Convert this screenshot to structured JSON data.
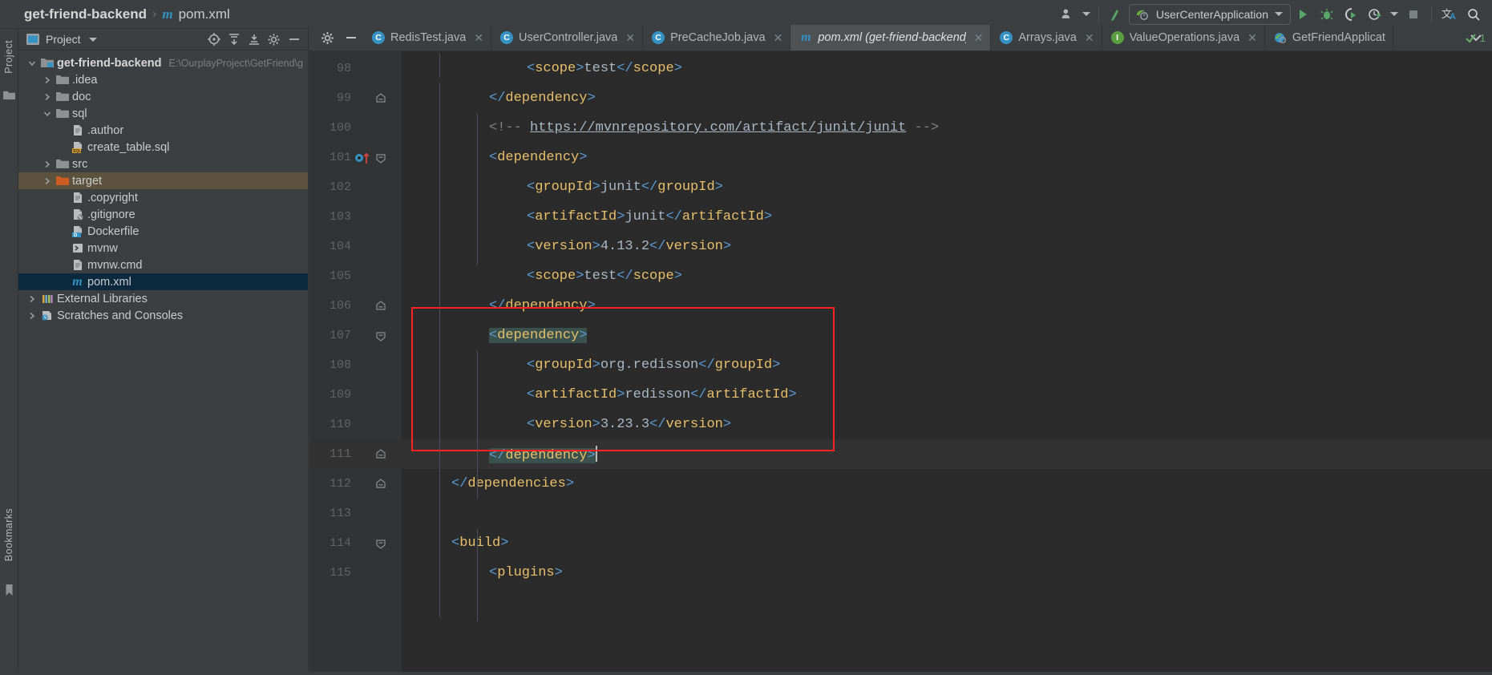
{
  "window": {
    "breadcrumb": {
      "project": "get-friend-backend",
      "separator": "›",
      "file_icon": "m",
      "file": "pom.xml"
    }
  },
  "toolbar": {
    "user_icon": "user-icon",
    "updates_icon": "vcs-update-icon",
    "run_config": {
      "label": "UserCenterApplication",
      "icon": "spring-boot-icon"
    },
    "run_label": "Run",
    "debug_label": "Debug",
    "coverage_label": "Run with Coverage",
    "profiler_label": "Profiler",
    "stop_label": "Stop",
    "translate_label": "Translate",
    "search_label": "Search Everywhere"
  },
  "stripes": {
    "left_top": "Project",
    "left_bottom": "Bookmarks"
  },
  "project_panel": {
    "title": "Project",
    "tools": [
      {
        "name": "select-opened-file-icon"
      },
      {
        "name": "expand-all-icon"
      },
      {
        "name": "collapse-all-icon"
      },
      {
        "name": "settings-gear-icon"
      },
      {
        "name": "hide-panel-icon"
      }
    ],
    "tree": [
      {
        "indent": 0,
        "arrow": "down",
        "icon": "module-folder",
        "label": "get-friend-backend",
        "path": "E:\\OurplayProject\\GetFriend\\g",
        "bold": true,
        "state": "normal"
      },
      {
        "indent": 1,
        "arrow": "right",
        "icon": "folder",
        "label": ".idea",
        "path": "",
        "bold": false,
        "state": "normal"
      },
      {
        "indent": 1,
        "arrow": "right",
        "icon": "folder",
        "label": "doc",
        "path": "",
        "bold": false,
        "state": "normal"
      },
      {
        "indent": 1,
        "arrow": "down",
        "icon": "folder",
        "label": "sql",
        "path": "",
        "bold": false,
        "state": "normal"
      },
      {
        "indent": 2,
        "arrow": "none",
        "icon": "file",
        "label": ".author",
        "path": "",
        "bold": false,
        "state": "normal"
      },
      {
        "indent": 2,
        "arrow": "none",
        "icon": "sql-file",
        "label": "create_table.sql",
        "path": "",
        "bold": false,
        "state": "normal"
      },
      {
        "indent": 1,
        "arrow": "right",
        "icon": "folder",
        "label": "src",
        "path": "",
        "bold": false,
        "state": "normal"
      },
      {
        "indent": 1,
        "arrow": "right",
        "icon": "folder-orange",
        "label": "target",
        "path": "",
        "bold": false,
        "state": "hover"
      },
      {
        "indent": 2,
        "arrow": "none",
        "icon": "file",
        "label": ".copyright",
        "path": "",
        "bold": false,
        "state": "normal"
      },
      {
        "indent": 2,
        "arrow": "none",
        "icon": "gitignore-file",
        "label": ".gitignore",
        "path": "",
        "bold": false,
        "state": "normal"
      },
      {
        "indent": 2,
        "arrow": "none",
        "icon": "docker-file",
        "label": "Dockerfile",
        "path": "",
        "bold": false,
        "state": "normal"
      },
      {
        "indent": 2,
        "arrow": "none",
        "icon": "script-file",
        "label": "mvnw",
        "path": "",
        "bold": false,
        "state": "normal"
      },
      {
        "indent": 2,
        "arrow": "none",
        "icon": "file",
        "label": "mvnw.cmd",
        "path": "",
        "bold": false,
        "state": "normal"
      },
      {
        "indent": 2,
        "arrow": "none",
        "icon": "maven-file",
        "label": "pom.xml",
        "path": "",
        "bold": false,
        "state": "selected"
      },
      {
        "indent": 0,
        "arrow": "right",
        "icon": "libraries",
        "label": "External Libraries",
        "path": "",
        "bold": false,
        "state": "normal"
      },
      {
        "indent": 0,
        "arrow": "right",
        "icon": "scratches",
        "label": "Scratches and Consoles",
        "path": "",
        "bold": false,
        "state": "normal"
      }
    ]
  },
  "editor_tabs": {
    "tools": [
      {
        "name": "settings-gear-icon"
      },
      {
        "name": "hide-tabs-icon"
      }
    ],
    "overflow_icon": "chevron-down-icon",
    "tabs": [
      {
        "label": "RedisTest.java",
        "icon": "class-icon",
        "badge": "C",
        "active": false,
        "closable": true,
        "run_marker": true
      },
      {
        "label": "UserController.java",
        "icon": "class-icon",
        "badge": "C",
        "active": false,
        "closable": true,
        "run_marker": false
      },
      {
        "label": "PreCacheJob.java",
        "icon": "class-icon",
        "badge": "C",
        "active": false,
        "closable": true,
        "run_marker": false
      },
      {
        "label": "pom.xml (get-friend-backend)",
        "icon": "maven-icon",
        "badge": "m",
        "active": true,
        "closable": true,
        "run_marker": false
      },
      {
        "label": "Arrays.java",
        "icon": "class-icon",
        "badge": "C",
        "active": false,
        "closable": true,
        "run_marker": false
      },
      {
        "label": "ValueOperations.java",
        "icon": "interface-icon",
        "badge": "I",
        "active": false,
        "closable": true,
        "run_marker": false
      },
      {
        "label": "GetFriendApplicat",
        "icon": "spring-icon",
        "badge": "S",
        "active": false,
        "closable": false,
        "run_marker": false
      }
    ]
  },
  "inspection": {
    "icon": "checkmark-icon",
    "count": "1",
    "color": "#62a866"
  },
  "code": {
    "language": "xml",
    "caret_line": 111,
    "lines": [
      {
        "num": 98,
        "indent": 3,
        "fold": "none",
        "tokens": [
          {
            "t": "br",
            "v": "<"
          },
          {
            "t": "tg",
            "v": "scope"
          },
          {
            "t": "br",
            "v": ">"
          },
          {
            "t": "tx",
            "v": "test"
          },
          {
            "t": "br",
            "v": "</"
          },
          {
            "t": "tg",
            "v": "scope"
          },
          {
            "t": "br",
            "v": ">"
          }
        ]
      },
      {
        "num": 99,
        "indent": 2,
        "fold": "end",
        "tokens": [
          {
            "t": "br",
            "v": "</"
          },
          {
            "t": "tg",
            "v": "dependency"
          },
          {
            "t": "br",
            "v": ">"
          }
        ]
      },
      {
        "num": 100,
        "indent": 2,
        "fold": "none",
        "tokens": [
          {
            "t": "cm",
            "v": "<!-- "
          },
          {
            "t": "lk",
            "v": "https://mvnrepository.com/artifact/junit/junit"
          },
          {
            "t": "cm",
            "v": " -->"
          }
        ]
      },
      {
        "num": 101,
        "indent": 2,
        "fold": "start",
        "marker": "bookmark-arrow",
        "tokens": [
          {
            "t": "br",
            "v": "<"
          },
          {
            "t": "tg",
            "v": "dependency"
          },
          {
            "t": "br",
            "v": ">"
          }
        ]
      },
      {
        "num": 102,
        "indent": 3,
        "fold": "none",
        "tokens": [
          {
            "t": "br",
            "v": "<"
          },
          {
            "t": "tg",
            "v": "groupId"
          },
          {
            "t": "br",
            "v": ">"
          },
          {
            "t": "tx",
            "v": "junit"
          },
          {
            "t": "br",
            "v": "</"
          },
          {
            "t": "tg",
            "v": "groupId"
          },
          {
            "t": "br",
            "v": ">"
          }
        ]
      },
      {
        "num": 103,
        "indent": 3,
        "fold": "none",
        "tokens": [
          {
            "t": "br",
            "v": "<"
          },
          {
            "t": "tg",
            "v": "artifactId"
          },
          {
            "t": "br",
            "v": ">"
          },
          {
            "t": "tx",
            "v": "junit"
          },
          {
            "t": "br",
            "v": "</"
          },
          {
            "t": "tg",
            "v": "artifactId"
          },
          {
            "t": "br",
            "v": ">"
          }
        ]
      },
      {
        "num": 104,
        "indent": 3,
        "fold": "none",
        "tokens": [
          {
            "t": "br",
            "v": "<"
          },
          {
            "t": "tg",
            "v": "version"
          },
          {
            "t": "br",
            "v": ">"
          },
          {
            "t": "tx",
            "v": "4.13.2"
          },
          {
            "t": "br",
            "v": "</"
          },
          {
            "t": "tg",
            "v": "version"
          },
          {
            "t": "br",
            "v": ">"
          }
        ]
      },
      {
        "num": 105,
        "indent": 3,
        "fold": "none",
        "tokens": [
          {
            "t": "br",
            "v": "<"
          },
          {
            "t": "tg",
            "v": "scope"
          },
          {
            "t": "br",
            "v": ">"
          },
          {
            "t": "tx",
            "v": "test"
          },
          {
            "t": "br",
            "v": "</"
          },
          {
            "t": "tg",
            "v": "scope"
          },
          {
            "t": "br",
            "v": ">"
          }
        ]
      },
      {
        "num": 106,
        "indent": 2,
        "fold": "end",
        "tokens": [
          {
            "t": "br",
            "v": "</"
          },
          {
            "t": "tg",
            "v": "dependency"
          },
          {
            "t": "br",
            "v": ">"
          }
        ]
      },
      {
        "num": 107,
        "indent": 2,
        "fold": "start",
        "highlight": true,
        "tokens": [
          {
            "t": "br",
            "v": "<"
          },
          {
            "t": "tg",
            "v": "dependency"
          },
          {
            "t": "br",
            "v": ">"
          }
        ]
      },
      {
        "num": 108,
        "indent": 3,
        "fold": "none",
        "tokens": [
          {
            "t": "br",
            "v": "<"
          },
          {
            "t": "tg",
            "v": "groupId"
          },
          {
            "t": "br",
            "v": ">"
          },
          {
            "t": "tx",
            "v": "org.redisson"
          },
          {
            "t": "br",
            "v": "</"
          },
          {
            "t": "tg",
            "v": "groupId"
          },
          {
            "t": "br",
            "v": ">"
          }
        ]
      },
      {
        "num": 109,
        "indent": 3,
        "fold": "none",
        "tokens": [
          {
            "t": "br",
            "v": "<"
          },
          {
            "t": "tg",
            "v": "artifactId"
          },
          {
            "t": "br",
            "v": ">"
          },
          {
            "t": "tx",
            "v": "redisson"
          },
          {
            "t": "br",
            "v": "</"
          },
          {
            "t": "tg",
            "v": "artifactId"
          },
          {
            "t": "br",
            "v": ">"
          }
        ]
      },
      {
        "num": 110,
        "indent": 3,
        "fold": "none",
        "tokens": [
          {
            "t": "br",
            "v": "<"
          },
          {
            "t": "tg",
            "v": "version"
          },
          {
            "t": "br",
            "v": ">"
          },
          {
            "t": "tx",
            "v": "3.23.3"
          },
          {
            "t": "br",
            "v": "</"
          },
          {
            "t": "tg",
            "v": "version"
          },
          {
            "t": "br",
            "v": ">"
          }
        ]
      },
      {
        "num": 111,
        "indent": 2,
        "fold": "end",
        "highlight": true,
        "caret": true,
        "tokens": [
          {
            "t": "br",
            "v": "</"
          },
          {
            "t": "tg",
            "v": "dependency"
          },
          {
            "t": "br",
            "v": ">"
          }
        ]
      },
      {
        "num": 112,
        "indent": 1,
        "fold": "end",
        "tokens": [
          {
            "t": "br",
            "v": "</"
          },
          {
            "t": "tg",
            "v": "dependencies"
          },
          {
            "t": "br",
            "v": ">"
          }
        ]
      },
      {
        "num": 113,
        "indent": 0,
        "fold": "none",
        "tokens": []
      },
      {
        "num": 114,
        "indent": 1,
        "fold": "start",
        "tokens": [
          {
            "t": "br",
            "v": "<"
          },
          {
            "t": "tg",
            "v": "build"
          },
          {
            "t": "br",
            "v": ">"
          }
        ]
      },
      {
        "num": 115,
        "indent": 2,
        "fold": "none",
        "tokens": [
          {
            "t": "br",
            "v": "<"
          },
          {
            "t": "tg",
            "v": "plugins"
          },
          {
            "t": "br",
            "v": ">"
          }
        ]
      }
    ]
  },
  "annotation": {
    "name": "red-highlight-rectangle",
    "color": "#ff2020"
  },
  "colors": {
    "background": "#3c3f41",
    "editor_background": "#2b2b2b",
    "gutter": "#313335",
    "tag": "#e8bf6a",
    "bracket": "#5b9bd5",
    "text": "#a9b7c6",
    "comment": "#808080",
    "selection": "#0d293e",
    "hover": "#5c523d",
    "match_highlight": "#3b514d",
    "accent_blue": "#3592c4",
    "accent_green": "#5a9e3f"
  }
}
